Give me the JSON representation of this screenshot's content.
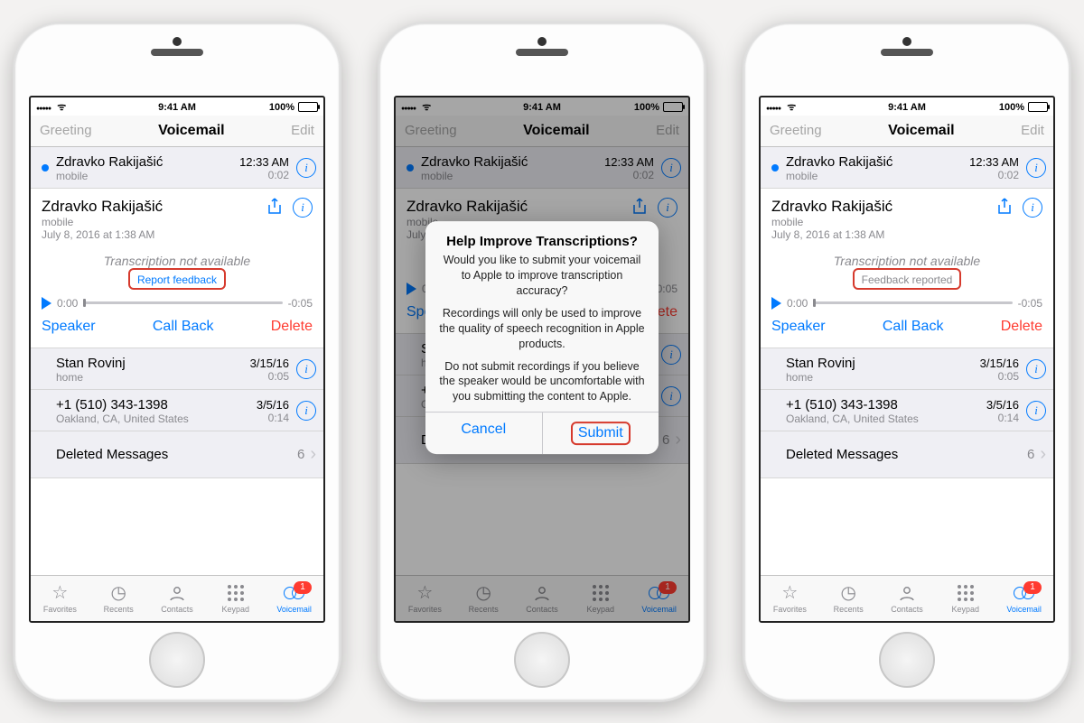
{
  "status": {
    "time": "9:41 AM",
    "battery_pct": "100%"
  },
  "nav": {
    "left": "Greeting",
    "title": "Voicemail",
    "right": "Edit"
  },
  "rows": {
    "top": {
      "name": "Zdravko Rakijašić",
      "sub": "mobile",
      "time": "12:33 AM",
      "dur": "0:02"
    },
    "stan": {
      "name": "Stan Rovinj",
      "sub": "home",
      "time": "3/15/16",
      "dur": "0:05"
    },
    "plus": {
      "name": "+1 (510) 343-1398",
      "sub": "Oakland, CA, United States",
      "time": "3/5/16",
      "dur": "0:14"
    },
    "deleted": {
      "name": "Deleted Messages",
      "count": "6"
    }
  },
  "expanded": {
    "name": "Zdravko Rakijašić",
    "sub": "mobile",
    "date": "July 8, 2016 at 1:38 AM",
    "transcription": "Transcription not available",
    "feedback_link": "Report feedback",
    "feedback_reported": "Feedback reported",
    "t_start": "0:00",
    "t_end": "-0:05"
  },
  "actions": {
    "speaker": "Speaker",
    "callback": "Call Back",
    "delete": "Delete"
  },
  "tabs": {
    "favorites": "Favorites",
    "recents": "Recents",
    "contacts": "Contacts",
    "keypad": "Keypad",
    "voicemail": "Voicemail",
    "badge": "1"
  },
  "alert": {
    "title": "Help Improve Transcriptions?",
    "p1": "Would you like to submit your voicemail to Apple to improve transcription accuracy?",
    "p2": "Recordings will only be used to improve the quality of speech recognition in Apple products.",
    "p3": "Do not submit recordings if you believe the speaker would be uncomfortable with you submitting the content to Apple.",
    "cancel": "Cancel",
    "submit": "Submit"
  }
}
